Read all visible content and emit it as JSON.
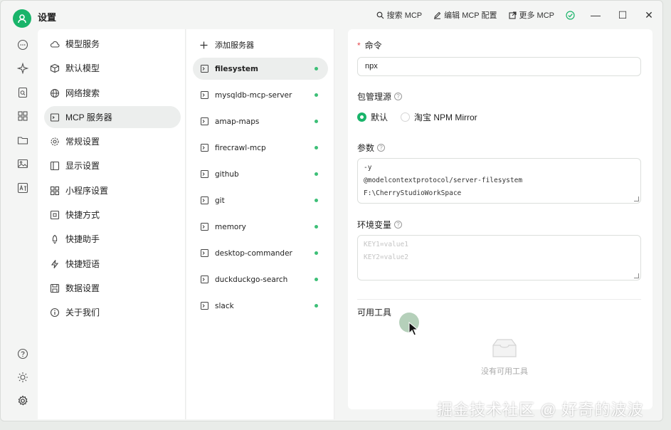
{
  "titlebar": {
    "title": "设置",
    "actions": [
      {
        "label": "搜索 MCP",
        "icon": "search-icon"
      },
      {
        "label": "编辑 MCP 配置",
        "icon": "edit-icon"
      },
      {
        "label": "更多 MCP",
        "icon": "external-link-icon"
      }
    ],
    "minimize": "—",
    "maximize": "☐",
    "close": "✕"
  },
  "nav": {
    "items": [
      {
        "label": "模型服务",
        "icon": "cloud-icon"
      },
      {
        "label": "默认模型",
        "icon": "cube-icon"
      },
      {
        "label": "网络搜索",
        "icon": "globe-icon"
      },
      {
        "label": "MCP 服务器",
        "icon": "terminal-icon"
      },
      {
        "label": "常规设置",
        "icon": "gear-icon"
      },
      {
        "label": "显示设置",
        "icon": "display-icon"
      },
      {
        "label": "小程序设置",
        "icon": "grid-icon"
      },
      {
        "label": "快捷方式",
        "icon": "command-icon"
      },
      {
        "label": "快捷助手",
        "icon": "rocket-icon"
      },
      {
        "label": "快捷短语",
        "icon": "zap-icon"
      },
      {
        "label": "数据设置",
        "icon": "save-icon"
      },
      {
        "label": "关于我们",
        "icon": "info-icon"
      }
    ]
  },
  "servers": {
    "add_label": "添加服务器",
    "items": [
      "filesystem",
      "mysqldb-mcp-server",
      "amap-maps",
      "firecrawl-mcp",
      "github",
      "git",
      "memory",
      "desktop-commander",
      "duckduckgo-search",
      "slack"
    ]
  },
  "detail": {
    "command_label": "命令",
    "command_value": "npx",
    "package_manager_label": "包管理源",
    "package_options": [
      "默认",
      "淘宝 NPM Mirror"
    ],
    "selected_package": "默认",
    "args_label": "参数",
    "args_lines": [
      "-y",
      "@modelcontextprotocol/server-filesystem",
      "F:\\CherryStudioWorkSpace"
    ],
    "env_label": "环境变量",
    "env_placeholder": [
      "KEY1=value1",
      "KEY2=value2"
    ],
    "tools_label": "可用工具",
    "empty_text": "没有可用工具"
  },
  "watermark": "掘金技术社区 @ 好奇的波波",
  "colors": {
    "accent": "#19b46a",
    "status_dot": "#3dbf77",
    "required": "#e5484d"
  }
}
